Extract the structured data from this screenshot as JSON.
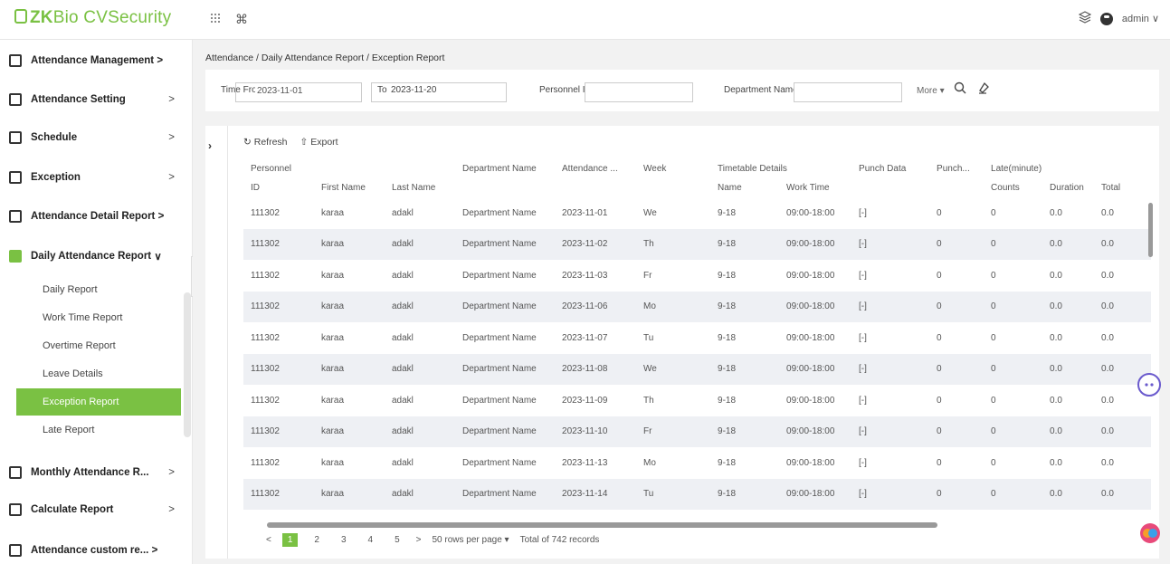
{
  "app": {
    "logo_zk": "ZK",
    "logo_bio": "Bio CVSecurity"
  },
  "header": {
    "user": "admin"
  },
  "sidebar": {
    "items": [
      {
        "label": "Attendance Management",
        "arrow": ">"
      },
      {
        "label": "Attendance Setting",
        "arrow": ">"
      },
      {
        "label": "Schedule",
        "arrow": ">"
      },
      {
        "label": "Exception",
        "arrow": ">"
      },
      {
        "label": "Attendance Detail Report",
        "arrow": ">"
      },
      {
        "label": "Daily Attendance Report",
        "arrow": "∨"
      },
      {
        "label": "Monthly Attendance R...",
        "arrow": ">"
      },
      {
        "label": "Calculate Report",
        "arrow": ">"
      },
      {
        "label": "Attendance custom re...",
        "arrow": ">"
      }
    ],
    "sub_items": [
      "Daily Report",
      "Work Time Report",
      "Overtime Report",
      "Leave Details",
      "Exception Report",
      "Late Report"
    ]
  },
  "breadcrumb": "Attendance / Daily Attendance Report / Exception Report",
  "filters": {
    "time_from_label": "Time From",
    "time_from_value": "2023-11-01",
    "to_label": "To",
    "to_value": "2023-11-20",
    "personnel_id_label": "Personnel ID",
    "department_label": "Department Name",
    "more_label": "More"
  },
  "toolbar": {
    "refresh": "Refresh",
    "export": "Export"
  },
  "table": {
    "group_headers": {
      "personnel": "Personnel",
      "department": "Department Name",
      "attendance": "Attendance ...",
      "week": "Week",
      "timetable": "Timetable Details",
      "punch_data": "Punch Data",
      "punch": "Punch...",
      "late": "Late(minute)"
    },
    "sub_headers": {
      "id": "ID",
      "first_name": "First Name",
      "last_name": "Last Name",
      "tt_name": "Name",
      "work_time": "Work Time",
      "counts": "Counts",
      "duration": "Duration",
      "total": "Total"
    },
    "rows": [
      [
        "111302",
        "karaa",
        "adakl",
        "Department Name",
        "2023-11-01",
        "We",
        "9-18",
        "09:00-18:00",
        "[-]",
        "0",
        "0",
        "0.0",
        "0.0"
      ],
      [
        "111302",
        "karaa",
        "adakl",
        "Department Name",
        "2023-11-02",
        "Th",
        "9-18",
        "09:00-18:00",
        "[-]",
        "0",
        "0",
        "0.0",
        "0.0"
      ],
      [
        "111302",
        "karaa",
        "adakl",
        "Department Name",
        "2023-11-03",
        "Fr",
        "9-18",
        "09:00-18:00",
        "[-]",
        "0",
        "0",
        "0.0",
        "0.0"
      ],
      [
        "111302",
        "karaa",
        "adakl",
        "Department Name",
        "2023-11-06",
        "Mo",
        "9-18",
        "09:00-18:00",
        "[-]",
        "0",
        "0",
        "0.0",
        "0.0"
      ],
      [
        "111302",
        "karaa",
        "adakl",
        "Department Name",
        "2023-11-07",
        "Tu",
        "9-18",
        "09:00-18:00",
        "[-]",
        "0",
        "0",
        "0.0",
        "0.0"
      ],
      [
        "111302",
        "karaa",
        "adakl",
        "Department Name",
        "2023-11-08",
        "We",
        "9-18",
        "09:00-18:00",
        "[-]",
        "0",
        "0",
        "0.0",
        "0.0"
      ],
      [
        "111302",
        "karaa",
        "adakl",
        "Department Name",
        "2023-11-09",
        "Th",
        "9-18",
        "09:00-18:00",
        "[-]",
        "0",
        "0",
        "0.0",
        "0.0"
      ],
      [
        "111302",
        "karaa",
        "adakl",
        "Department Name",
        "2023-11-10",
        "Fr",
        "9-18",
        "09:00-18:00",
        "[-]",
        "0",
        "0",
        "0.0",
        "0.0"
      ],
      [
        "111302",
        "karaa",
        "adakl",
        "Department Name",
        "2023-11-13",
        "Mo",
        "9-18",
        "09:00-18:00",
        "[-]",
        "0",
        "0",
        "0.0",
        "0.0"
      ],
      [
        "111302",
        "karaa",
        "adakl",
        "Department Name",
        "2023-11-14",
        "Tu",
        "9-18",
        "09:00-18:00",
        "[-]",
        "0",
        "0",
        "0.0",
        "0.0"
      ]
    ]
  },
  "pagination": {
    "prev": "<",
    "next": ">",
    "pages": [
      "1",
      "2",
      "3",
      "4",
      "5"
    ],
    "rows_per_page": "50 rows per page",
    "total": "Total of 742 records"
  },
  "colors": {
    "accent": "#7ac143",
    "stripe": "#eef0f4",
    "background": "#f2f2f2"
  },
  "icons": [
    "apps-grid-icon",
    "command-icon",
    "layers-icon",
    "user-icon",
    "refresh-icon",
    "export-icon",
    "search-icon",
    "clear-icon",
    "assistant-icon",
    "ai-brain-icon"
  ]
}
